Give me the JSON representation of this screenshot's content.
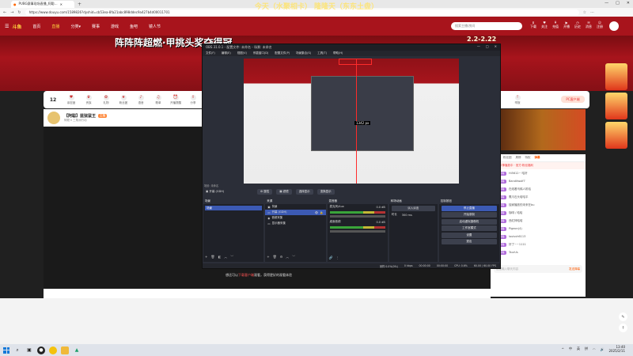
{
  "browser": {
    "tab_title": "PUBG赛事现场直播_阿聪…",
    "url": "https://www.douyu.com/1589826?dyshid=cb53ea-8fa21abc898ddec9a427b4d00011701",
    "window_controls": [
      "—",
      "□",
      "✕"
    ]
  },
  "site": {
    "logo": "斗鱼",
    "nav": [
      "首页",
      "直播",
      "分类▾",
      "赛事",
      "游戏",
      "鱼吧",
      "镜人节"
    ],
    "search_placeholder": "搜索主播/房间",
    "header_icons": [
      "下载",
      "关注",
      "充值",
      "开播",
      "历史",
      "消息",
      "注册"
    ],
    "banner_slogan": "阵阵阵超燃·甲挑头奖夺得冠",
    "banner_dates": "2.2-2.22",
    "overlay_title": "今天（水聚相卡）\n隆隆天（东东土盘）"
  },
  "room": {
    "viewer_count": "12",
    "items": [
      "亲密度",
      "贵族",
      "礼物",
      "粉丝团",
      "语音",
      "歌单",
      "开播提醒",
      "分享",
      "举报"
    ],
    "pc_button": "PC客户端",
    "streamer_name": "【阿聪】蓝狱鼠王",
    "streamer_level": "主播",
    "streamer_sub": "阿聪 ▾ 三角洲行动",
    "player_hint_pre": "想还可以",
    "player_hint_link": "下载客户端",
    "player_hint_post": "观看，获得更好的观看体验"
  },
  "right_panel": {
    "tabs": [
      "贵宾",
      "粉丝团",
      "周榜",
      "特权",
      "弹幕"
    ],
    "notice": "阿聪车神播放中 · 官方·粉丝福利",
    "rows": [
      {
        "user": "Hi5612~ 哈好",
        "badge": "20 阿聪"
      },
      {
        "user": "Banditwolf7",
        "badge": "19 阿聪"
      },
      {
        "user": "在线看乌鸦人机哈",
        "badge": "21 阿聪"
      },
      {
        "user": "鹰爪石头哈哈平",
        "badge": "20 阿聪"
      },
      {
        "user": "独家播放的未来在bu",
        "badge": "23 阿聪"
      },
      {
        "user": "咖啡 / 哈哈",
        "badge": "15 阿聪"
      },
      {
        "user": "西红柿哈哈",
        "badge": "21 阿聪"
      },
      {
        "user": "Pigeon(4)",
        "badge": "18 阿聪"
      },
      {
        "user": "louisvh6113",
        "badge": "20 阿聪"
      },
      {
        "user": "好了~~1111",
        "badge": "14 阿聪"
      },
      {
        "user": "TaurUs",
        "badge": "19 阿聪"
      }
    ],
    "input_placeholder": "这里输入聊天内容",
    "send_label": "发送弹幕"
  },
  "obs": {
    "title": "OBS 31.0.1 - 配置文件: 未命名 - 场景: 未命名",
    "menu": [
      "文件(F)",
      "编辑(E)",
      "视图(V)",
      "停靠窗口(D)",
      "配置文件(P)",
      "场景集合(S)",
      "工具(T)",
      "帮助(H)"
    ],
    "size_label": "1342 px",
    "scene_label": "场景: 未命名",
    "source_selected": "▣ 开幕 (GDH)",
    "toolbar_buttons": [
      "⚙ 属性",
      "▦ 滤镜",
      "选择显示",
      "变换显示"
    ],
    "docks": {
      "scenes": {
        "title": "场景",
        "items": [
          "场景"
        ]
      },
      "sources": {
        "title": "来源",
        "items": [
          "背景",
          "开幕 (GDH)",
          "音频采集",
          "显示器采集"
        ]
      },
      "mixer": {
        "title": "混音器",
        "channels": [
          "麦克风/Aux",
          "桌面音频"
        ],
        "levels": [
          "0.0 dB",
          "0.0 dB"
        ]
      },
      "transitions": {
        "title": "转场动画",
        "type": "淡入淡出",
        "duration_label": "时长",
        "duration": "300 ms"
      },
      "controls": {
        "title": "控制按钮",
        "buttons": [
          "停止直播",
          "开始录制",
          "启动虚拟摄像机",
          "工作室模式",
          "设置",
          "退出"
        ]
      }
    },
    "status": [
      "采样 0.0%(0%)",
      "0 kbps",
      "00:00:00",
      "00:00:00",
      "CPU: 0.6%",
      "60.00 / 60.00 FPS"
    ]
  },
  "taskbar": {
    "time": "13:40",
    "date": "2025/2/11",
    "tray": [
      "^",
      "中",
      "英",
      "拼"
    ]
  }
}
